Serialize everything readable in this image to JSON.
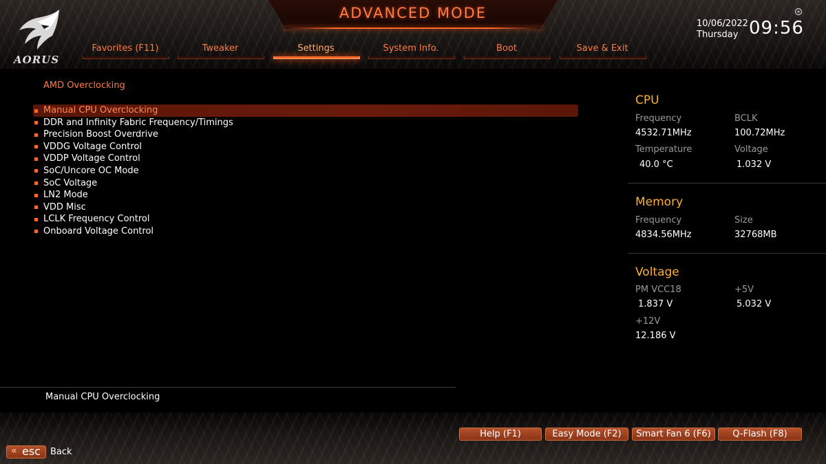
{
  "header": {
    "title": "ADVANCED MODE",
    "logo_text": "AORUS",
    "date": "10/06/2022",
    "weekday": "Thursday",
    "time": "09:56"
  },
  "tabs": [
    {
      "label": "Favorites (F11)",
      "active": false
    },
    {
      "label": "Tweaker",
      "active": false
    },
    {
      "label": "Settings",
      "active": true
    },
    {
      "label": "System Info.",
      "active": false
    },
    {
      "label": "Boot",
      "active": false
    },
    {
      "label": "Save & Exit",
      "active": false
    }
  ],
  "main": {
    "section_title": "AMD Overclocking",
    "items": [
      "Manual CPU Overclocking",
      "DDR and Infinity Fabric Frequency/Timings",
      "Precision Boost Overdrive",
      "VDDG Voltage Control",
      "VDDP Voltage Control",
      "SoC/Uncore OC Mode",
      "SoC Voltage",
      "LN2 Mode",
      "VDD Misc",
      "LCLK Frequency Control",
      "Onboard Voltage Control"
    ],
    "selected_index": 0,
    "help_text": "Manual CPU Overclocking"
  },
  "panel": {
    "cpu": {
      "heading": "CPU",
      "frequency_label": "Frequency",
      "frequency_value": "4532.71MHz",
      "bclk_label": "BCLK",
      "bclk_value": "100.72MHz",
      "temperature_label": "Temperature",
      "temperature_value": "40.0 °C",
      "voltage_label": "Voltage",
      "voltage_value": "1.032 V"
    },
    "memory": {
      "heading": "Memory",
      "frequency_label": "Frequency",
      "frequency_value": "4834.56MHz",
      "size_label": "Size",
      "size_value": "32768MB"
    },
    "voltage": {
      "heading": "Voltage",
      "pmvcc18_label": "PM VCC18",
      "pmvcc18_value": "1.837 V",
      "p5v_label": "+5V",
      "p5v_value": "5.032 V",
      "p12v_label": "+12V",
      "p12v_value": "12.186 V"
    }
  },
  "footer": {
    "help_button": "Help (F1)",
    "easy_mode_button": "Easy Mode (F2)",
    "smart_fan_button": "Smart Fan 6 (F6)",
    "qflash_button": "Q-Flash (F8)",
    "esc_arrows": "«",
    "esc_label": "esc",
    "back_label": "Back"
  },
  "colors": {
    "accent": "#ff6a2a",
    "accent_text": "#ff7a44",
    "heading_gold": "#ffb030",
    "selected_row": "#6a1a0a",
    "label_gray": "#9a9a9a"
  },
  "icons": [
    "aorus-eagle-icon",
    "gear-icon",
    "bullet-square-icon",
    "esc-arrows-icon"
  ]
}
